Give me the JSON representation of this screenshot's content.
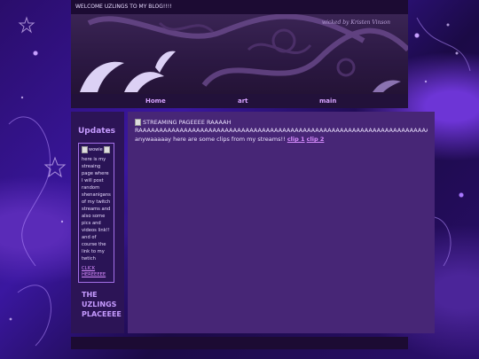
{
  "header": {
    "welcome": "WELCOME UZLINGS TO MY BLOG!!!!",
    "banner_sign": "wicked by Kristen Vinson"
  },
  "nav": {
    "items": [
      {
        "label": "Home"
      },
      {
        "label": "art"
      },
      {
        "label": "main"
      }
    ]
  },
  "sidebar": {
    "title": "Updates",
    "image_alt": "wowie",
    "text": "here is my streaing page where I will post random shenanigans of my twitch streams and also some pics and videos link!! and of course the link to my twtich",
    "link": "CLICK HEREEEEE",
    "footer_lines": [
      "THE",
      "UZLINGS",
      "PLACEEEE"
    ]
  },
  "main": {
    "image_alt": "STREAMING PAGEEEE RAAAAH",
    "line": "RAAAAAAAAAAAAAAAAAAAAAAAAAAAAAAAAAAAAAAAAAAAAAAAAAAAAAAAAAAAAAAAAAAAAAAAAAAAAAAAAAH",
    "intro": "anywaaaaay here are some clips from my streams!!",
    "clip1": "clip 1",
    "clip2": "clip 2"
  },
  "colors": {
    "accent": "#c69bff",
    "link": "#d88cff",
    "panel": "#472676",
    "bar": "#1c0b33"
  }
}
